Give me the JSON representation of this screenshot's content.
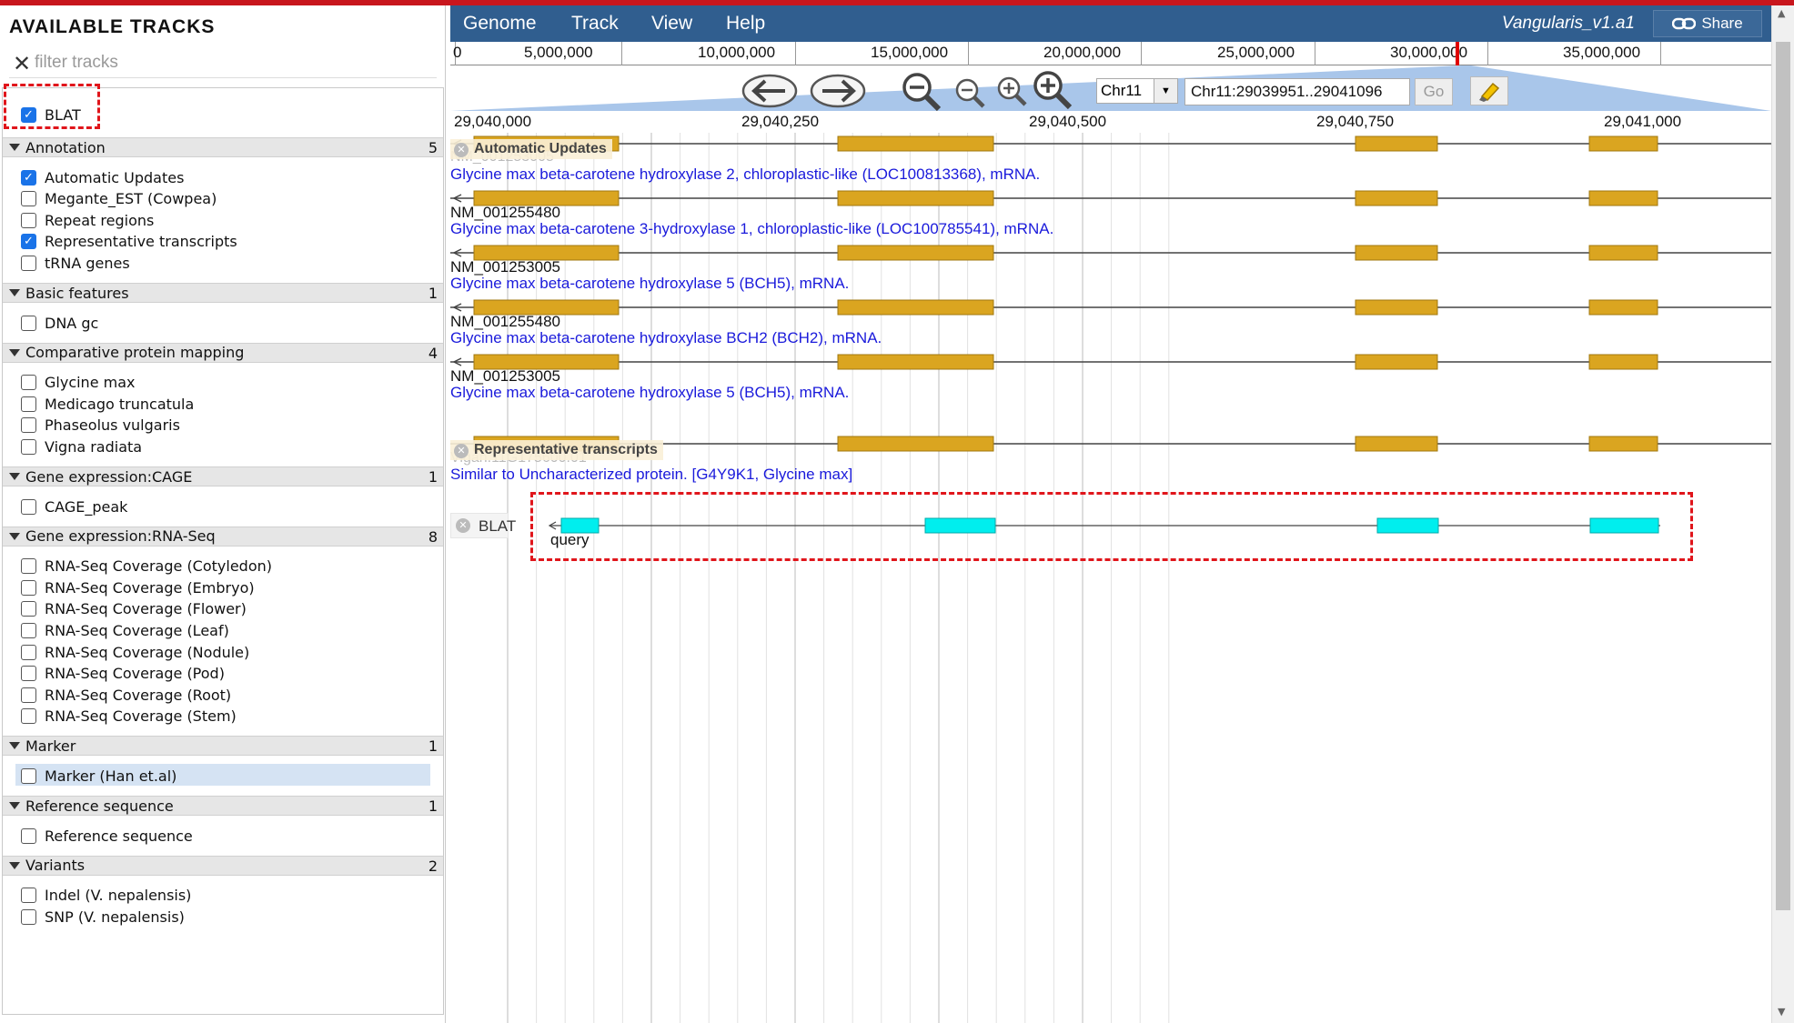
{
  "sidebar": {
    "title": "AVAILABLE TRACKS",
    "filter_placeholder": "filter tracks",
    "pinned": [
      {
        "label": "BLAT",
        "checked": true
      }
    ],
    "categories": [
      {
        "name": "Annotation",
        "count": "5",
        "tracks": [
          {
            "label": "Automatic Updates",
            "checked": true
          },
          {
            "label": "Megante_EST (Cowpea)",
            "checked": false
          },
          {
            "label": "Repeat regions",
            "checked": false
          },
          {
            "label": "Representative transcripts",
            "checked": true
          },
          {
            "label": "tRNA genes",
            "checked": false
          }
        ]
      },
      {
        "name": "Basic features",
        "count": "1",
        "tracks": [
          {
            "label": "DNA gc",
            "checked": false
          }
        ]
      },
      {
        "name": "Comparative protein mapping",
        "count": "4",
        "tracks": [
          {
            "label": "Glycine max",
            "checked": false
          },
          {
            "label": "Medicago truncatula",
            "checked": false
          },
          {
            "label": "Phaseolus vulgaris",
            "checked": false
          },
          {
            "label": "Vigna radiata",
            "checked": false
          }
        ]
      },
      {
        "name": "Gene expression:CAGE",
        "count": "1",
        "tracks": [
          {
            "label": "CAGE_peak",
            "checked": false
          }
        ]
      },
      {
        "name": "Gene expression:RNA-Seq",
        "count": "8",
        "tracks": [
          {
            "label": "RNA-Seq Coverage (Cotyledon)",
            "checked": false
          },
          {
            "label": "RNA-Seq Coverage (Embryo)",
            "checked": false
          },
          {
            "label": "RNA-Seq Coverage (Flower)",
            "checked": false
          },
          {
            "label": "RNA-Seq Coverage (Leaf)",
            "checked": false
          },
          {
            "label": "RNA-Seq Coverage (Nodule)",
            "checked": false
          },
          {
            "label": "RNA-Seq Coverage (Pod)",
            "checked": false
          },
          {
            "label": "RNA-Seq Coverage (Root)",
            "checked": false
          },
          {
            "label": "RNA-Seq Coverage (Stem)",
            "checked": false
          }
        ]
      },
      {
        "name": "Marker",
        "count": "1",
        "tracks": [
          {
            "label": "Marker (Han et.al)",
            "checked": false
          }
        ]
      },
      {
        "name": "Reference sequence",
        "count": "1",
        "tracks": [
          {
            "label": "Reference sequence",
            "checked": false
          }
        ]
      },
      {
        "name": "Variants",
        "count": "2",
        "tracks": [
          {
            "label": "Indel (V. nepalensis)",
            "checked": false
          },
          {
            "label": "SNP (V. nepalensis)",
            "checked": false
          }
        ]
      }
    ]
  },
  "menubar": {
    "items": [
      "Genome",
      "Track",
      "View",
      "Help"
    ],
    "dataset": "Vangularis_v1.a1",
    "share_label": "Share"
  },
  "overview_ruler": {
    "labels": [
      "0",
      "5,000,000",
      "10,000,000",
      "15,000,000",
      "20,000,000",
      "25,000,000",
      "30,000,000",
      "35,000,000"
    ]
  },
  "navigation": {
    "chromosome": "Chr11",
    "location": "Chr11:29039951..29041096",
    "go_label": "Go"
  },
  "detail_ruler": {
    "labels": [
      "29,040,000",
      "29,040,250",
      "29,040,500",
      "29,040,750",
      "29,041,000"
    ]
  },
  "tracks": {
    "automatic_updates": {
      "label": "Automatic Updates",
      "overlap_name": "NM_001253005",
      "features": [
        {
          "name": "",
          "desc": "Glycine max beta-carotene hydroxylase 2, chloroplastic-like (LOC100813368), mRNA."
        },
        {
          "name": "NM_001255480",
          "desc": "Glycine max beta-carotene 3-hydroxylase 1, chloroplastic-like (LOC100785541), mRNA."
        },
        {
          "name": "NM_001253005",
          "desc": "Glycine max beta-carotene hydroxylase 5 (BCH5), mRNA."
        },
        {
          "name": "NM_001255480",
          "desc": "Glycine max beta-carotene hydroxylase BCH2 (BCH2), mRNA."
        },
        {
          "name": "NM_001253005",
          "desc": "Glycine max beta-carotene hydroxylase 5 (BCH5), mRNA."
        }
      ]
    },
    "representative_transcripts": {
      "label": "Representative transcripts",
      "overlap_name": "Vigan.11G175600.01",
      "desc": "Similar to Uncharacterized protein. [G4Y9K1, Glycine max]"
    },
    "blat": {
      "label": "BLAT",
      "feature_name": "query"
    }
  },
  "colors": {
    "menubar": "#305e8f",
    "exon": "#daa520",
    "blat_exon": "#00eeee",
    "highlight_dash": "#e0151b",
    "desc_text": "#1a1adb"
  }
}
